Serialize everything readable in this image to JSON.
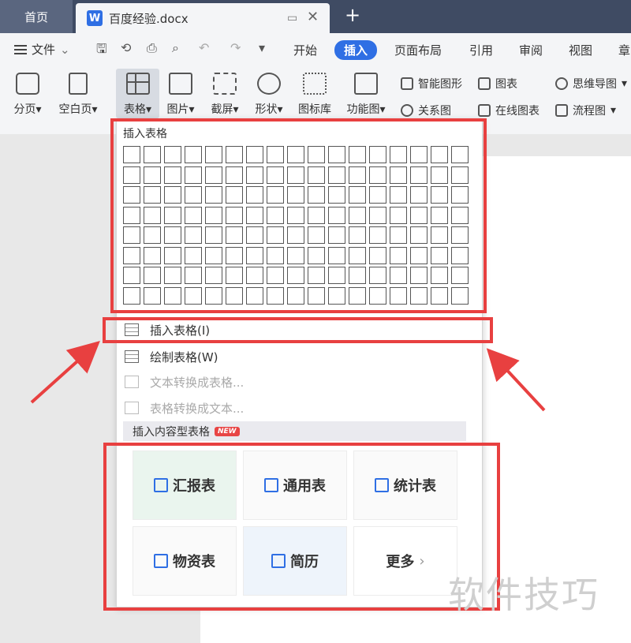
{
  "tabs": {
    "home": "首页",
    "doc_logo": "W",
    "doc_title": "百度经验.docx"
  },
  "menu": {
    "file_label": "文件",
    "tabs": [
      "开始",
      "插入",
      "页面布局",
      "引用",
      "审阅",
      "视图",
      "章"
    ]
  },
  "tools": {
    "page_break": "分页",
    "blank_page": "空白页",
    "table": "表格",
    "picture": "图片",
    "screenshot": "截屏",
    "shape": "形状",
    "icon_lib": "图标库",
    "function_chart": "功能图",
    "smart_shape": "智能图形",
    "chart": "图表",
    "mind_map": "思维导图",
    "relation_chart": "关系图",
    "online_chart": "在线图表",
    "flowchart": "流程图"
  },
  "dropdown": {
    "header": "插入表格",
    "items": [
      {
        "label": "插入表格(I)",
        "enabled": true
      },
      {
        "label": "绘制表格(W)",
        "enabled": true
      },
      {
        "label": "文本转换成表格...",
        "enabled": false
      },
      {
        "label": "表格转换成文本...",
        "enabled": false
      }
    ],
    "content_section": "插入内容型表格",
    "new_badge": "NEW",
    "cards": [
      "汇报表",
      "通用表",
      "统计表",
      "物资表",
      "简历",
      "更多"
    ]
  },
  "watermark": "软件技巧",
  "colors": {
    "accent": "#2f6fe4",
    "tabbar": "#3f4b63",
    "highlight_red": "#e84040"
  }
}
